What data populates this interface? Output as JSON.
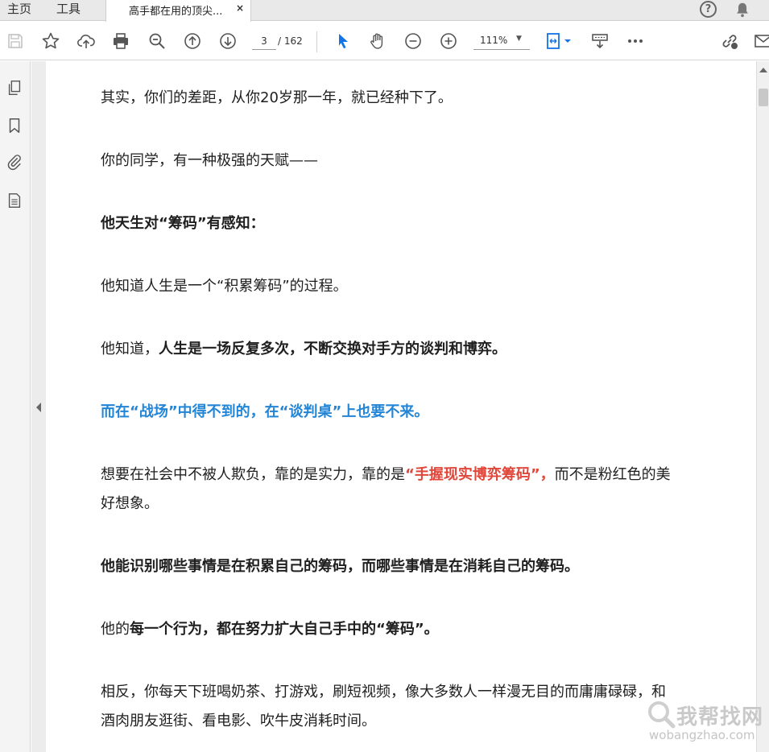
{
  "tabbar": {
    "home_label": "主页",
    "tools_label": "工具",
    "doc_tab_label": "高手都在用的顶尖...",
    "close_glyph": "×",
    "help_glyph": "?"
  },
  "toolbar": {
    "icons": [
      "save-icon",
      "star-icon",
      "upload-icon",
      "print-icon",
      "zoom-out-magnifier-icon",
      "page-up-icon",
      "page-down-icon",
      "select-cursor-icon",
      "hand-icon",
      "zoom-minus-icon",
      "zoom-plus-icon",
      "fit-page-icon",
      "read-mode-icon",
      "more-icon",
      "share-link-icon",
      "email-icon"
    ],
    "current_page": "3",
    "total_pages": "/ 162",
    "zoom": "111%",
    "accent_color": "#1473e6"
  },
  "left_rail": {
    "icons": [
      "pages-icon",
      "bookmark-icon",
      "attachment-icon",
      "document-properties-icon"
    ]
  },
  "document": {
    "colors": {
      "text": "#1f1f1f",
      "blue": "#2385d6",
      "red": "#e0463a"
    },
    "p1": "其实，你们的差距，从你20岁那一年，就已经种下了。",
    "p2": "你的同学，有一种极强的天赋——",
    "p3": "他天生对“筹码”有感知：",
    "p4": "他知道人生是一个“积累筹码”的过程。",
    "p5_a": "他知道，",
    "p5_b": "人生是一场反复多次，不断交换对手方的谈判和博弈。",
    "p6": "而在“战场”中得不到的，在“谈判桌”上也要不来。",
    "p7_a": "想要在社会中不被人欺负，靠的是实力，靠的是",
    "p7_b": "“手握现实博弈筹码”，",
    "p7_c": "而不是粉红色的美",
    "p7_d": "好想象。",
    "p8": "他能识别哪些事情是在积累自己的筹码，而哪些事情是在消耗自己的筹码。",
    "p9_a": "他的",
    "p9_b": "每一个行为，都在努力扩大自己手中的“筹码”。",
    "p10_a": "相反，你每天下班喝奶茶、打游戏，刷短视频，像大多数人一样漫无目的而庸庸碌碌，和",
    "p10_b": "酒肉朋友逛街、看电影、吹牛皮消耗时间。"
  },
  "watermark": {
    "cn": "我帮找网",
    "en": "wobangzhao.com"
  }
}
